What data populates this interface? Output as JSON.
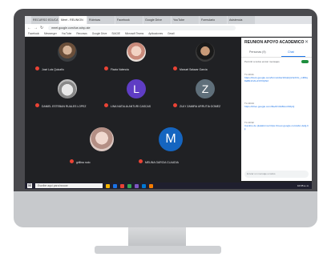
{
  "browser": {
    "tabs": [
      "RECURSO EDUCATIVO",
      "Meet - REUNION",
      "Rúbricas",
      "Facebook",
      "Google Drive",
      "YouTube",
      "Formulario",
      "Asistencia"
    ],
    "url": "meet.google.com/iue-xdnp-ste",
    "bookmarks": [
      "Facebook",
      "Messenger",
      "YouTube",
      "Recursos",
      "Google Drive",
      "SIAGIE",
      "Microsoft Teams",
      "Aplicaciones",
      "Gmail"
    ]
  },
  "participants": [
    {
      "name": "José Luis Quicaño",
      "avatar": "photo"
    },
    {
      "name": "Flavia Valencia",
      "avatar": "photo2"
    },
    {
      "name": "Manuel Salazar García",
      "avatar": "photo3"
    },
    {
      "name": "DANIEL ESTEBAN RUALES LOPEZ",
      "avatar": "photo4"
    },
    {
      "name": "LINA NATALIA ANTURI CASCAS",
      "avatar": "letter",
      "letter": "L",
      "color": "#5f3dc4"
    },
    {
      "name": "ZULY ZAMIRA URRUTIA GOMEZ",
      "avatar": "letter",
      "letter": "Z",
      "color": "#5f6f7a"
    },
    {
      "name": "grillina rodo",
      "avatar": "photo5"
    },
    {
      "name": "MELINA GARCIA CLAUDIA",
      "avatar": "letter",
      "letter": "M",
      "color": "#1565c0"
    }
  ],
  "panel": {
    "title": "REUNION APOYO ACADEMICO",
    "tab_people": "Personas (9)",
    "tab_chat": "Chat",
    "toggle_label": "Permitir a todos enviar mensajes",
    "messages": [
      {
        "who": "Tú  10:21",
        "text": "https://docs.google.com/forms/d/e/1FAIpQLScK3c_mM9q8aB0JxVtLcN7rPqW2"
      },
      {
        "who": "Tú  10:24",
        "text": "https://drive.google.com/file/d/1hA8kLmN0pQ"
      },
      {
        "who": "Tú  10:32",
        "text": "Cambio de plataforma https://meet.google.com/abc-defg-hij"
      }
    ],
    "input_placeholder": "Enviar un mensaje a todos"
  },
  "taskbar": {
    "search_placeholder": "Escribe aquí para buscar",
    "time": "10:35 a. m.",
    "icon_colors": [
      "#f4b400",
      "#1a73e8",
      "#e94235",
      "#34a853",
      "#7e57c2",
      "#0078d4",
      "#f57c00"
    ]
  }
}
